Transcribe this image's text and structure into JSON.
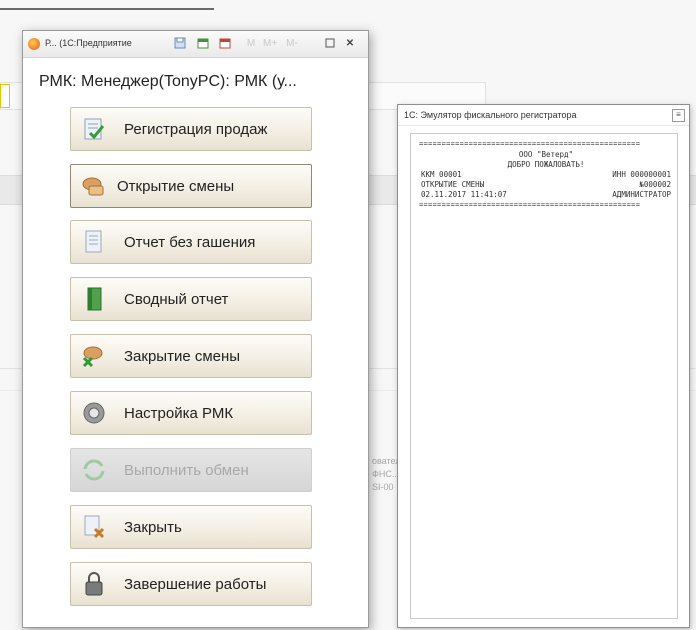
{
  "background": {
    "blurred_text": "овательское ПО\nФНС...\nSI-00"
  },
  "rmk_window": {
    "title_bar": "Р... (1С:Предприятие",
    "header": "РМК: Менеджер(TonyPC): РМК (у...",
    "buttons": [
      {
        "label": "Регистрация продаж",
        "icon": "cash-register-icon",
        "enabled": true
      },
      {
        "label": "Открытие смены",
        "icon": "open-shift-icon",
        "enabled": true,
        "focused": true
      },
      {
        "label": "Отчет без гашения",
        "icon": "report-document-icon",
        "enabled": true
      },
      {
        "label": "Сводный отчет",
        "icon": "summary-report-icon",
        "enabled": true
      },
      {
        "label": "Закрытие смены",
        "icon": "close-shift-icon",
        "enabled": true
      },
      {
        "label": "Настройка РМК",
        "icon": "settings-gear-icon",
        "enabled": true
      },
      {
        "label": "Выполнить обмен",
        "icon": "exchange-icon",
        "enabled": false
      },
      {
        "label": "Закрыть",
        "icon": "close-document-icon",
        "enabled": true
      },
      {
        "label": "Завершение работы",
        "icon": "shutdown-lock-icon",
        "enabled": true
      }
    ]
  },
  "fiscal_window": {
    "title": "1С: Эмулятор фискального регистратора",
    "receipt": {
      "separator": "=================================================",
      "org": "ООО \"Ветерд\"",
      "greeting": "ДОБРО ПОЖАЛОВАТЬ!",
      "kkm_label": "ККМ 00001",
      "inn_label": "ИНН 000000001",
      "doc_title": "ОТКРЫТИЕ СМЕНЫ",
      "doc_number": "№000002",
      "datetime": "02.11.2017 11:41:07",
      "cashier": "АДМИНИСТРАТОР"
    }
  },
  "colors": {
    "button_face": "#f3efe4",
    "button_border": "#c8c0aa",
    "disabled_face": "#dcdcdc",
    "disabled_text": "#a9a9a9"
  }
}
